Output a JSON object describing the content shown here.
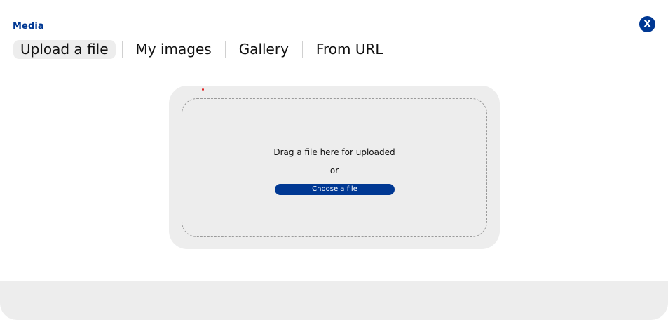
{
  "modal": {
    "title": "Media",
    "close_label": "X"
  },
  "tabs": [
    {
      "label": "Upload a file",
      "active": true
    },
    {
      "label": "My images",
      "active": false
    },
    {
      "label": "Gallery",
      "active": false
    },
    {
      "label": "From URL",
      "active": false
    }
  ],
  "upload": {
    "drag_text": "Drag a file here for uploaded",
    "or_text": "or",
    "choose_label": "Choose a file"
  },
  "colors": {
    "accent": "#003893",
    "panel_bg": "#ededed"
  }
}
